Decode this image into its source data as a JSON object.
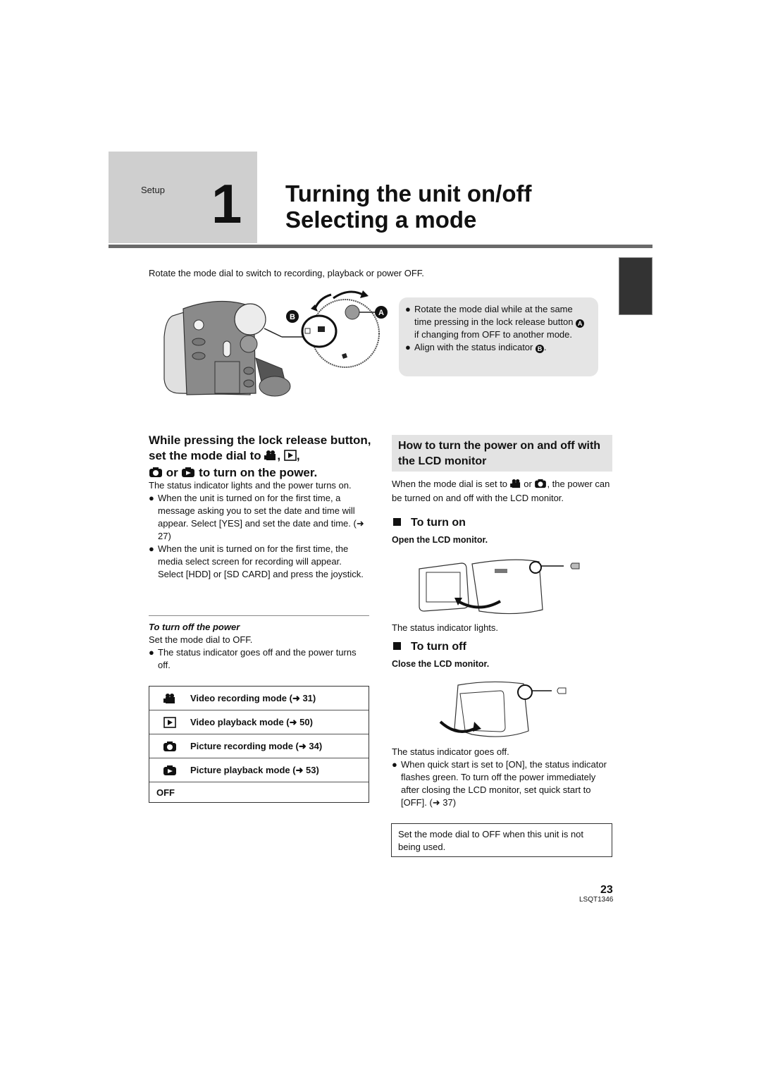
{
  "header": {
    "section_label": "Setup",
    "chapter_number": "1",
    "title_line1": "Turning the unit on/off",
    "title_line2": "Selecting a mode"
  },
  "intro": "Rotate the mode dial to switch to recording, playback or power OFF.",
  "figure1": {
    "callout_a": "A",
    "callout_b": "B"
  },
  "dial_notes": {
    "items": [
      {
        "pre": "Rotate the mode dial while at the same time pressing in the lock release button ",
        "marker": "A",
        "post": " if changing from OFF to another mode."
      },
      {
        "pre": "Align with the status indicator ",
        "marker": "B",
        "post": "."
      }
    ]
  },
  "step": {
    "heading_part1": "While pressing the lock release button, set the mode dial to ",
    "heading_sep1": ", ",
    "heading_sep2": ",",
    "heading_or": " or ",
    "heading_end": " to turn on the power.",
    "description": "The status indicator lights and the power turns on.",
    "bullets": [
      "When the unit is turned on for the first time, a message asking you to set the date and time will appear. Select [YES] and set the date and time. (➜ 27)",
      "When the unit is turned on for the first time, the media select screen for recording will appear. Select [HDD] or [SD CARD] and press the joystick."
    ]
  },
  "turn_off_power": {
    "heading": "To turn off the power",
    "text": "Set the mode dial to OFF.",
    "bullet": "The status indicator goes off and the power turns off."
  },
  "mode_table": {
    "rows": [
      {
        "icon": "video-camera-icon",
        "label": "Video recording mode (➜ 31)"
      },
      {
        "icon": "video-playback-icon",
        "label": "Video playback mode (➜ 50)"
      },
      {
        "icon": "camera-icon",
        "label": "Picture recording mode (➜ 34)"
      },
      {
        "icon": "picture-playback-icon",
        "label": "Picture playback mode (➜ 53)"
      },
      {
        "icon": "",
        "label": "OFF"
      }
    ]
  },
  "lcd_section": {
    "heading": "How to turn the power on and off with the LCD monitor",
    "intro_pre": "When the mode dial is set to ",
    "intro_or": " or ",
    "intro_post": ", the power can be turned on and off with the LCD monitor.",
    "turn_on": {
      "heading": "To turn on",
      "instruction": "Open the LCD monitor.",
      "result": "The status indicator lights."
    },
    "turn_off": {
      "heading": "To turn off",
      "instruction": "Close the LCD monitor.",
      "result": "The status indicator goes off.",
      "bullet": "When quick start is set to [ON], the status indicator flashes green. To turn off the power immediately after closing the LCD monitor, set quick start to [OFF]. (➜ 37)"
    }
  },
  "note_frame": "Set the mode dial to OFF when this unit is not being used.",
  "footer": {
    "page_number": "23",
    "doc_code": "LSQT1346"
  }
}
